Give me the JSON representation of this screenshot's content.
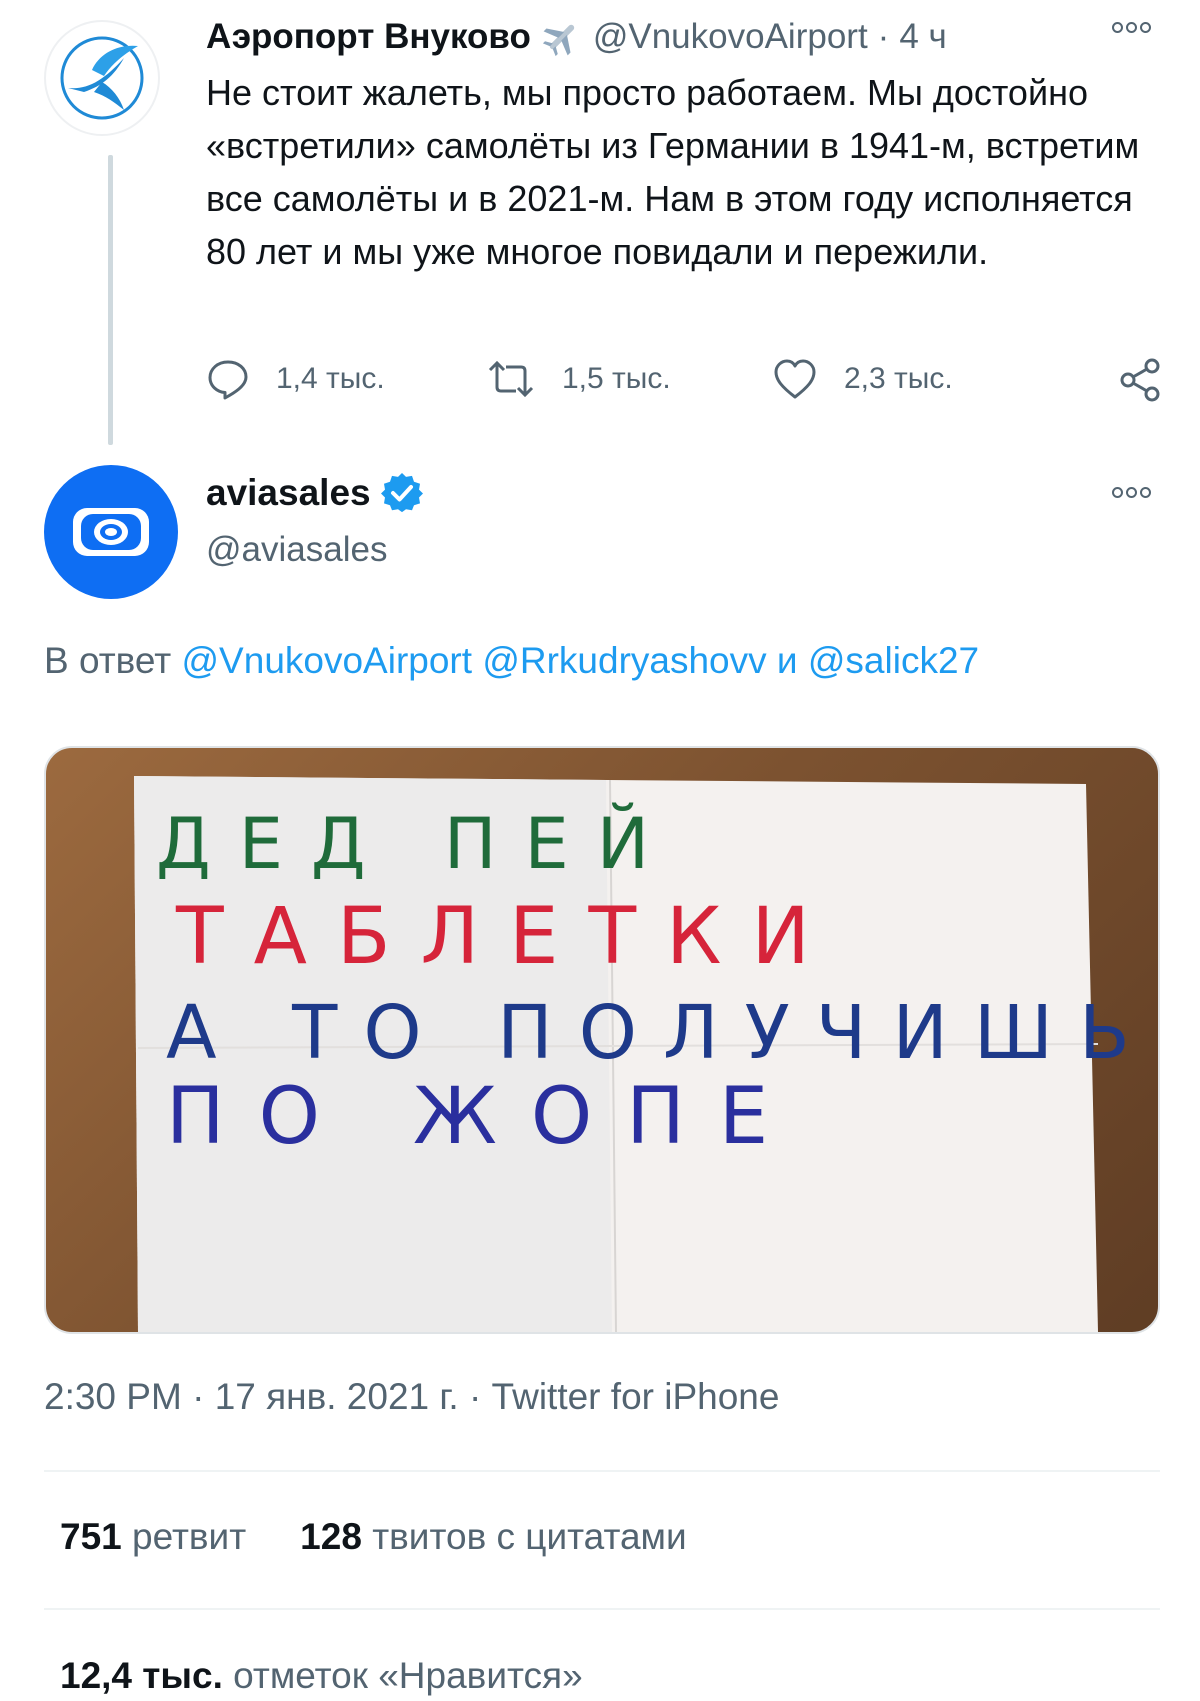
{
  "parent_tweet": {
    "author_name": "Аэропорт Внуково",
    "handle": "@VnukovoAirport",
    "separator": "·",
    "time": "4 ч",
    "text": "Не стоит жалеть, мы просто работаем. Мы достойно «встретили» самолёты из Германии в 1941-м, встретим все самолёты и в 2021-м. Нам в этом году исполняется 80 лет и мы уже многое повидали и пережили.",
    "replies": "1,4 тыс.",
    "retweets": "1,5 тыс.",
    "likes": "2,3 тыс.",
    "emoji": "plane-emoji"
  },
  "main_tweet": {
    "author_name": "aviasales",
    "handle": "@aviasales",
    "verified": true,
    "reply_prefix": "В ответ",
    "reply_mention_1": "@VnukovoAirport",
    "reply_mention_2": "@Rrkudryashovv",
    "reply_conjunction": "и",
    "reply_mention_3": "@salick27",
    "image": {
      "description_icon": "handwritten-note-photo",
      "line1": "ДЕД ПЕЙ",
      "line2": "ТАБЛЕТКИ",
      "line3": "А ТО ПОЛУЧИШЬ",
      "line4": "ПО ЖОПЕ"
    },
    "time": "2:30 PM",
    "date": "17 янв. 2021 г.",
    "source": "Twitter for iPhone",
    "separator": "·",
    "retweet_count": "751",
    "retweet_label": "ретвит",
    "quote_count": "128",
    "quote_label": "твитов с цитатами",
    "like_count": "12,4 тыс.",
    "like_label": "отметок «Нравится»"
  },
  "colors": {
    "link": "#1d9bf0",
    "secondary_text": "#536471",
    "primary_text": "#0f1419",
    "aviasales_blue": "#0e6ef3"
  }
}
